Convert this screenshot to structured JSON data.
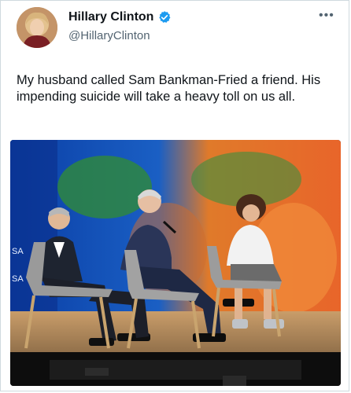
{
  "tweet": {
    "author_name": "Hillary Clinton",
    "author_handle": "@HillaryClinton",
    "text": "My husband called Sam Bankman-Fried a friend. His impending suicide will take a heavy toll on us all.",
    "more_label": "•••",
    "verified_icon": "verified-badge-icon",
    "avatar_icon": "avatar",
    "colors": {
      "verified": "#1d9bf0",
      "handle": "#536471",
      "text": "#0f1419"
    }
  },
  "media": {
    "kind": "photo",
    "screen_lettering": [
      "SA",
      "SA"
    ]
  }
}
